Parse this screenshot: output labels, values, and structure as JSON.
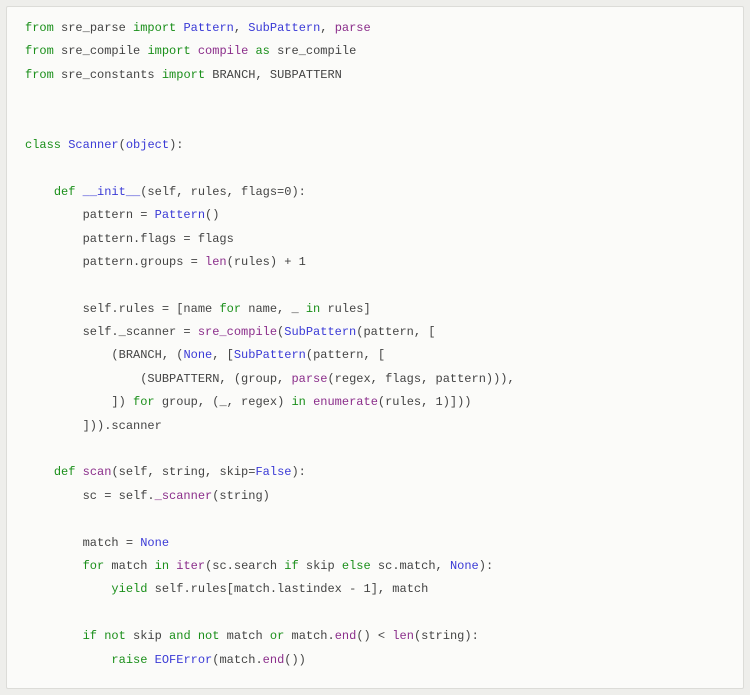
{
  "code": {
    "lines": [
      [
        {
          "t": "from ",
          "c": "kw"
        },
        {
          "t": "sre_parse ",
          "c": "nm"
        },
        {
          "t": "import ",
          "c": "kw"
        },
        {
          "t": "Pattern",
          "c": "cls"
        },
        {
          "t": ", ",
          "c": "nm"
        },
        {
          "t": "SubPattern",
          "c": "cls"
        },
        {
          "t": ", ",
          "c": "nm"
        },
        {
          "t": "parse",
          "c": "fn"
        }
      ],
      [
        {
          "t": "from ",
          "c": "kw"
        },
        {
          "t": "sre_compile ",
          "c": "nm"
        },
        {
          "t": "import ",
          "c": "kw"
        },
        {
          "t": "compile",
          "c": "fn"
        },
        {
          "t": " as ",
          "c": "kw"
        },
        {
          "t": "sre_compile",
          "c": "nm"
        }
      ],
      [
        {
          "t": "from ",
          "c": "kw"
        },
        {
          "t": "sre_constants ",
          "c": "nm"
        },
        {
          "t": "import ",
          "c": "kw"
        },
        {
          "t": "BRANCH, SUBPATTERN",
          "c": "nm"
        }
      ],
      [],
      [],
      [
        {
          "t": "class ",
          "c": "kw"
        },
        {
          "t": "Scanner",
          "c": "cls"
        },
        {
          "t": "(",
          "c": "nm"
        },
        {
          "t": "object",
          "c": "cls"
        },
        {
          "t": "):",
          "c": "nm"
        }
      ],
      [],
      [
        {
          "t": "    ",
          "c": "nm"
        },
        {
          "t": "def ",
          "c": "kw"
        },
        {
          "t": "__init__",
          "c": "dunder"
        },
        {
          "t": "(self, rules, flags=",
          "c": "nm"
        },
        {
          "t": "0",
          "c": "num"
        },
        {
          "t": "):",
          "c": "nm"
        }
      ],
      [
        {
          "t": "        pattern = ",
          "c": "nm"
        },
        {
          "t": "Pattern",
          "c": "cls"
        },
        {
          "t": "()",
          "c": "nm"
        }
      ],
      [
        {
          "t": "        pattern.flags = flags",
          "c": "nm"
        }
      ],
      [
        {
          "t": "        pattern.groups = ",
          "c": "nm"
        },
        {
          "t": "len",
          "c": "fn"
        },
        {
          "t": "(rules) + ",
          "c": "nm"
        },
        {
          "t": "1",
          "c": "num"
        }
      ],
      [],
      [
        {
          "t": "        self.rules = [name ",
          "c": "nm"
        },
        {
          "t": "for ",
          "c": "kw"
        },
        {
          "t": "name, _ ",
          "c": "nm"
        },
        {
          "t": "in ",
          "c": "kw"
        },
        {
          "t": "rules]",
          "c": "nm"
        }
      ],
      [
        {
          "t": "        self._scanner = ",
          "c": "nm"
        },
        {
          "t": "sre_compile",
          "c": "fn"
        },
        {
          "t": "(",
          "c": "nm"
        },
        {
          "t": "SubPattern",
          "c": "cls"
        },
        {
          "t": "(pattern, [",
          "c": "nm"
        }
      ],
      [
        {
          "t": "            (BRANCH, (",
          "c": "nm"
        },
        {
          "t": "None",
          "c": "cls"
        },
        {
          "t": ", [",
          "c": "nm"
        },
        {
          "t": "SubPattern",
          "c": "cls"
        },
        {
          "t": "(pattern, [",
          "c": "nm"
        }
      ],
      [
        {
          "t": "                (SUBPATTERN, (group, ",
          "c": "nm"
        },
        {
          "t": "parse",
          "c": "fn"
        },
        {
          "t": "(regex, flags, pattern))),",
          "c": "nm"
        }
      ],
      [
        {
          "t": "            ]) ",
          "c": "nm"
        },
        {
          "t": "for ",
          "c": "kw"
        },
        {
          "t": "group, (_, regex) ",
          "c": "nm"
        },
        {
          "t": "in ",
          "c": "kw"
        },
        {
          "t": "enumerate",
          "c": "fn"
        },
        {
          "t": "(rules, ",
          "c": "nm"
        },
        {
          "t": "1",
          "c": "num"
        },
        {
          "t": ")]))",
          "c": "nm"
        }
      ],
      [
        {
          "t": "        ])).scanner",
          "c": "nm"
        }
      ],
      [],
      [
        {
          "t": "    ",
          "c": "nm"
        },
        {
          "t": "def ",
          "c": "kw"
        },
        {
          "t": "scan",
          "c": "fn"
        },
        {
          "t": "(self, string, skip=",
          "c": "nm"
        },
        {
          "t": "False",
          "c": "cls"
        },
        {
          "t": "):",
          "c": "nm"
        }
      ],
      [
        {
          "t": "        sc = self.",
          "c": "nm"
        },
        {
          "t": "_scanner",
          "c": "fn"
        },
        {
          "t": "(string)",
          "c": "nm"
        }
      ],
      [],
      [
        {
          "t": "        match = ",
          "c": "nm"
        },
        {
          "t": "None",
          "c": "cls"
        }
      ],
      [
        {
          "t": "        ",
          "c": "nm"
        },
        {
          "t": "for ",
          "c": "kw"
        },
        {
          "t": "match ",
          "c": "nm"
        },
        {
          "t": "in ",
          "c": "kw"
        },
        {
          "t": "iter",
          "c": "fn"
        },
        {
          "t": "(sc.search ",
          "c": "nm"
        },
        {
          "t": "if ",
          "c": "kw"
        },
        {
          "t": "skip ",
          "c": "nm"
        },
        {
          "t": "else ",
          "c": "kw"
        },
        {
          "t": "sc.match, ",
          "c": "nm"
        },
        {
          "t": "None",
          "c": "cls"
        },
        {
          "t": "):",
          "c": "nm"
        }
      ],
      [
        {
          "t": "            ",
          "c": "nm"
        },
        {
          "t": "yield ",
          "c": "kw"
        },
        {
          "t": "self.rules[match.lastindex - ",
          "c": "nm"
        },
        {
          "t": "1",
          "c": "num"
        },
        {
          "t": "], match",
          "c": "nm"
        }
      ],
      [],
      [
        {
          "t": "        ",
          "c": "nm"
        },
        {
          "t": "if ",
          "c": "kw"
        },
        {
          "t": "not ",
          "c": "kw"
        },
        {
          "t": "skip ",
          "c": "nm"
        },
        {
          "t": "and ",
          "c": "kw"
        },
        {
          "t": "not ",
          "c": "kw"
        },
        {
          "t": "match ",
          "c": "nm"
        },
        {
          "t": "or ",
          "c": "kw"
        },
        {
          "t": "match.",
          "c": "nm"
        },
        {
          "t": "end",
          "c": "fn"
        },
        {
          "t": "() < ",
          "c": "nm"
        },
        {
          "t": "len",
          "c": "fn"
        },
        {
          "t": "(string):",
          "c": "nm"
        }
      ],
      [
        {
          "t": "            ",
          "c": "nm"
        },
        {
          "t": "raise ",
          "c": "kw"
        },
        {
          "t": "EOFError",
          "c": "cls"
        },
        {
          "t": "(match.",
          "c": "nm"
        },
        {
          "t": "end",
          "c": "fn"
        },
        {
          "t": "())",
          "c": "nm"
        }
      ]
    ]
  }
}
